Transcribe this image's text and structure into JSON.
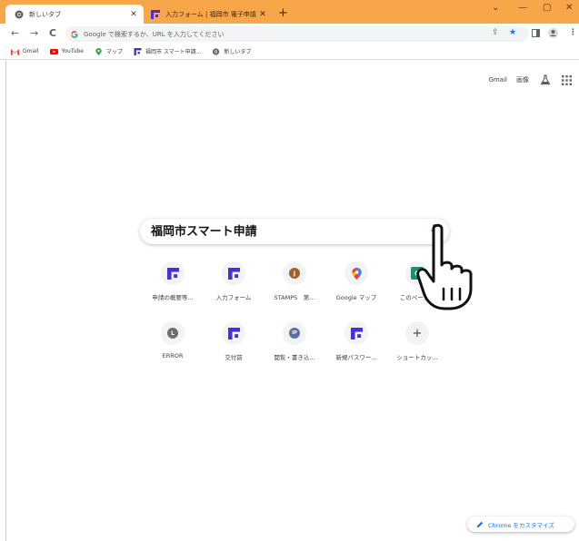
{
  "tabs": [
    {
      "title": "新しいタブ",
      "close": "✕",
      "active": true
    },
    {
      "title": "入力フォーム | 福岡市 電子申請 [市",
      "close": "✕",
      "active": false
    }
  ],
  "newtab": "+",
  "window_controls": {
    "minimize": "—",
    "maximize": "▢",
    "close": "✕",
    "collapse": "⌄"
  },
  "toolbar": {
    "back": "←",
    "forward": "→",
    "reload": "C",
    "omnibox_placeholder": "Google で検索するか、URL を入力してください",
    "share": "⇪",
    "bookmark_star": "★",
    "menu": "⋮"
  },
  "bookmarks": [
    {
      "label": "Gmail",
      "icon": "gmail-icon"
    },
    {
      "label": "YouTube",
      "icon": "youtube-icon"
    },
    {
      "label": "マップ",
      "icon": "maps-icon"
    },
    {
      "label": "福岡市 スマート申請...",
      "icon": "fukuoka-icon"
    },
    {
      "label": "新しいタブ",
      "icon": "chrome-icon"
    }
  ],
  "top_links": {
    "gmail": "Gmail",
    "images": "画像"
  },
  "search": {
    "query": "福岡市スマート申請"
  },
  "shortcuts_row1": [
    {
      "label": "申請の概要等...",
      "icon": "fukuoka-icon"
    },
    {
      "label": "入力フォーム",
      "icon": "fukuoka-icon"
    },
    {
      "label": "STAMPS　第...",
      "icon": "letter",
      "letter": "J",
      "color": "#a0612a"
    },
    {
      "label": "Google マップ",
      "icon": "maps-icon"
    },
    {
      "label": "このページ...",
      "icon": "letter",
      "letter": "C",
      "color": "#1e8e6e"
    }
  ],
  "shortcuts_row2": [
    {
      "label": "ERROR",
      "icon": "letter",
      "letter": "L",
      "color": "#6e6e6e"
    },
    {
      "label": "交付前",
      "icon": "fukuoka-icon"
    },
    {
      "label": "閲覧・書き込...",
      "icon": "letter",
      "letter": "IP",
      "color": "#5b6ea8"
    },
    {
      "label": "新規パスワー...",
      "icon": "fukuoka-icon"
    },
    {
      "label": "ショートカッ...",
      "icon": "add-icon",
      "glyph": "+"
    }
  ],
  "customize": {
    "label": "Chrome をカスタマイズ"
  },
  "colors": {
    "titlebar": "#f7a64a",
    "fukuoka_purple": "#4a2fd4",
    "link_blue": "#1a73e8"
  }
}
